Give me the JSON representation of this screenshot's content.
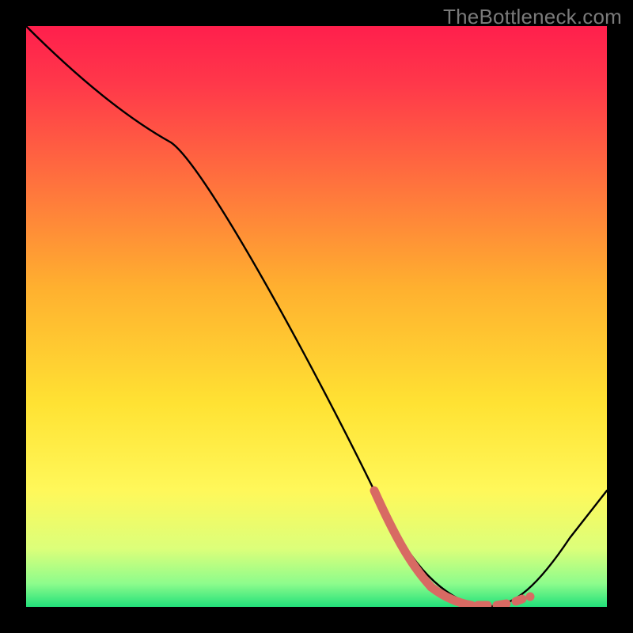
{
  "watermark": "TheBottleneck.com",
  "chart_data": {
    "type": "line",
    "title": "",
    "xlabel": "",
    "ylabel": "",
    "xlim": [
      0,
      100
    ],
    "ylim": [
      0,
      100
    ],
    "grid": false,
    "series": [
      {
        "name": "curve",
        "x": [
          0,
          25,
          60,
          70,
          80,
          85,
          100
        ],
        "y": [
          100,
          80,
          20,
          3,
          0,
          3,
          20
        ],
        "stroke": "#000000"
      }
    ],
    "highlight_segment": {
      "name": "highlight",
      "x": [
        60,
        70,
        78,
        80,
        82,
        85
      ],
      "y": [
        20,
        3,
        0.5,
        0,
        0.5,
        3
      ],
      "stroke": "#d86a63"
    },
    "gradient": {
      "stops": [
        {
          "offset": 0.0,
          "color": "#ff1f4c"
        },
        {
          "offset": 0.1,
          "color": "#ff384a"
        },
        {
          "offset": 0.25,
          "color": "#ff6b3f"
        },
        {
          "offset": 0.45,
          "color": "#ffb02f"
        },
        {
          "offset": 0.65,
          "color": "#ffe233"
        },
        {
          "offset": 0.8,
          "color": "#fff85a"
        },
        {
          "offset": 0.9,
          "color": "#dcff7a"
        },
        {
          "offset": 0.96,
          "color": "#8dfc8c"
        },
        {
          "offset": 1.0,
          "color": "#22e07a"
        }
      ]
    }
  }
}
